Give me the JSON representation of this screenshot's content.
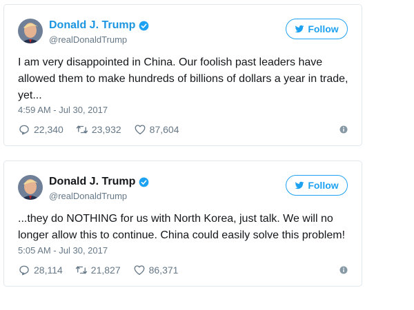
{
  "tweets": [
    {
      "name": "Donald J. Trump",
      "handle": "@realDonaldTrump",
      "follow_label": "Follow",
      "text": "I am very disappointed in China. Our foolish past leaders have allowed them to make hundreds of billions of dollars a year in trade, yet...",
      "timestamp": "4:59 AM - Jul 30, 2017",
      "replies": "22,340",
      "retweets": "23,932",
      "likes": "87,604",
      "name_color": "#1b95e0"
    },
    {
      "name": "Donald J. Trump",
      "handle": "@realDonaldTrump",
      "follow_label": "Follow",
      "text": "...they do NOTHING for us with North Korea, just talk. We will no longer allow this to continue. China could easily solve this problem!",
      "timestamp": "5:05 AM - Jul 30, 2017",
      "replies": "28,114",
      "retweets": "21,827",
      "likes": "86,371",
      "name_color": "#14171a"
    }
  ],
  "icons": {
    "verified": "verified-badge-icon",
    "bird": "twitter-bird-icon",
    "reply": "reply-icon",
    "retweet": "retweet-icon",
    "like": "heart-icon",
    "info": "info-icon"
  },
  "colors": {
    "accent": "#1da1f2",
    "text": "#14171a",
    "muted": "#657786",
    "border": "#e1e8ed"
  }
}
